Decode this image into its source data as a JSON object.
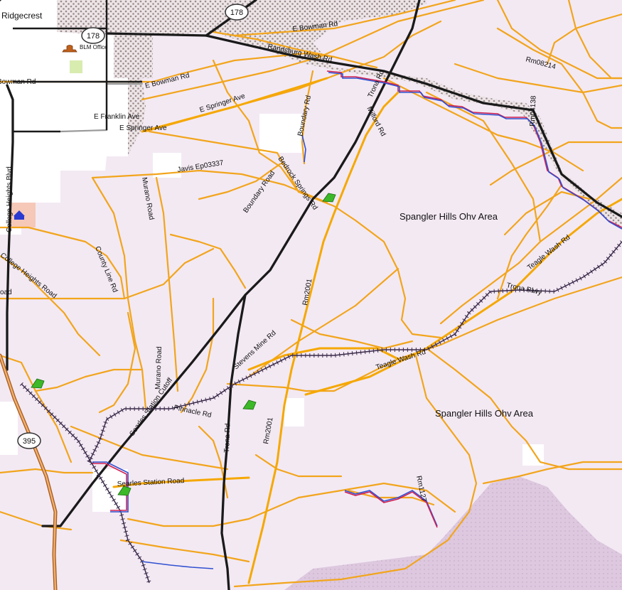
{
  "map": {
    "places": {
      "ridgecrest": "Ridgecrest",
      "blm_office": "BLM Office",
      "spangler_north": "Spangler Hills Ohv Area",
      "spangler_south": "Spangler Hills Ohv Area"
    },
    "shields": {
      "hwy178_a": "178",
      "hwy178_b": "178",
      "hwy395": "395"
    },
    "roads": {
      "e_bowman_top": "E Bowman Rd",
      "randsburg_wash": "Randsburg Wash Rd",
      "bowman_west": "Bowman Rd",
      "e_bowman_mid": "E Bowman Rd",
      "e_springer_ave_1": "E Springer Ave",
      "e_franklin_ave": "E Franklin Ave",
      "e_springer_ave_2": "E Springer Ave",
      "trona_rd_top": "Trona Rd",
      "milford_rd": "Milford Rd",
      "boundary_rd_top": "Boundary Rd",
      "rm08214": "Rm08214",
      "rm04138": "Rm04138",
      "javis": "Javis Ep03337",
      "bedrock_springs": "Bedrock Springs Rd",
      "boundary_road": "Boundary Road",
      "murano_road_top": "Murano Road",
      "college_heights_blvd": "College Heights Blvd",
      "college_heights_road": "College Heights Road",
      "road_w": "oad",
      "county_line": "County Line Rd",
      "rm2001_mid": "Rm2001",
      "teagle_wash_ne": "Teagle Wash Rd",
      "trona_rlwy": "Trona Rlwy",
      "stevens_mine": "Stevens Mine Rd",
      "murano_road_low": "Murano Road",
      "teagle_wash_mid": "Teagle Wash Rd",
      "searles_station_cutoff": "Searles Station Cutoff",
      "pinnacle_rd": "Pinnacle Rd",
      "trona_rd_low": "Trona Rd",
      "rm2001_low": "Rm2001",
      "searles_station_road": "Searles Station Road",
      "rm1127": "Rm1127"
    },
    "icon_names": [
      "museum-icon",
      "school-icon",
      "campground-icon"
    ],
    "colors": {
      "background": "#f3e9f3",
      "urban": "#ffffff",
      "road_minor": "#f2a51c",
      "road_major": "#f5a800",
      "highway": "#1a1a1a",
      "hwy395_casing": "#a85a1a",
      "hwy395_fill": "#f0b070",
      "railway": "#3a2a4a",
      "boundary_red": "#d02050",
      "boundary_blue": "#3050d0",
      "campground": "#3cb828"
    }
  }
}
